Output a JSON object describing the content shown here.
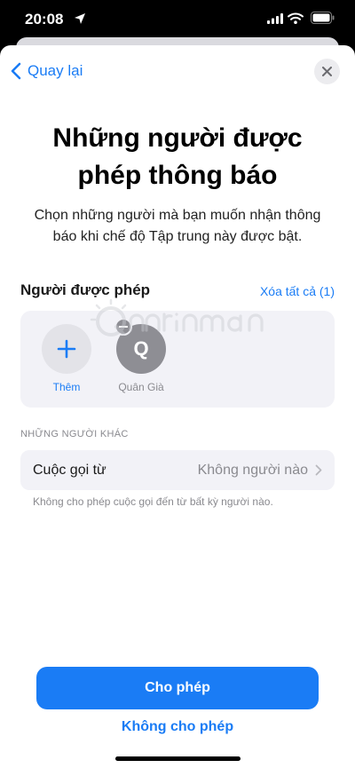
{
  "status_bar": {
    "time": "20:08"
  },
  "nav": {
    "back_label": "Quay lại"
  },
  "header": {
    "title": "Những người được phép thông báo",
    "subtitle": "Chọn những người mà bạn muốn nhận thông báo khi chế độ Tập trung này được bật."
  },
  "allowed": {
    "label": "Người được phép",
    "clear_all": "Xóa tất cả (1)",
    "add_label": "Thêm",
    "contact": {
      "initial": "Q",
      "name": "Quân Già"
    }
  },
  "others": {
    "header": "NHỮNG NGƯỜI KHÁC",
    "calls_label": "Cuộc gọi từ",
    "calls_value": "Không người nào",
    "calls_footnote": "Không cho phép cuộc gọi đến từ bất kỳ người nào."
  },
  "actions": {
    "allow": "Cho phép",
    "deny": "Không cho phép"
  },
  "watermark": {
    "text": "uantrimang"
  },
  "colors": {
    "accent": "#1a7cf5",
    "card": "#f2f2f7",
    "avatar": "#8e8e94"
  },
  "icons": [
    "location-icon",
    "signal-icon",
    "wifi-icon",
    "battery-icon",
    "chevron-left-icon",
    "close-icon",
    "plus-icon",
    "minus-icon",
    "chevron-right-icon"
  ]
}
